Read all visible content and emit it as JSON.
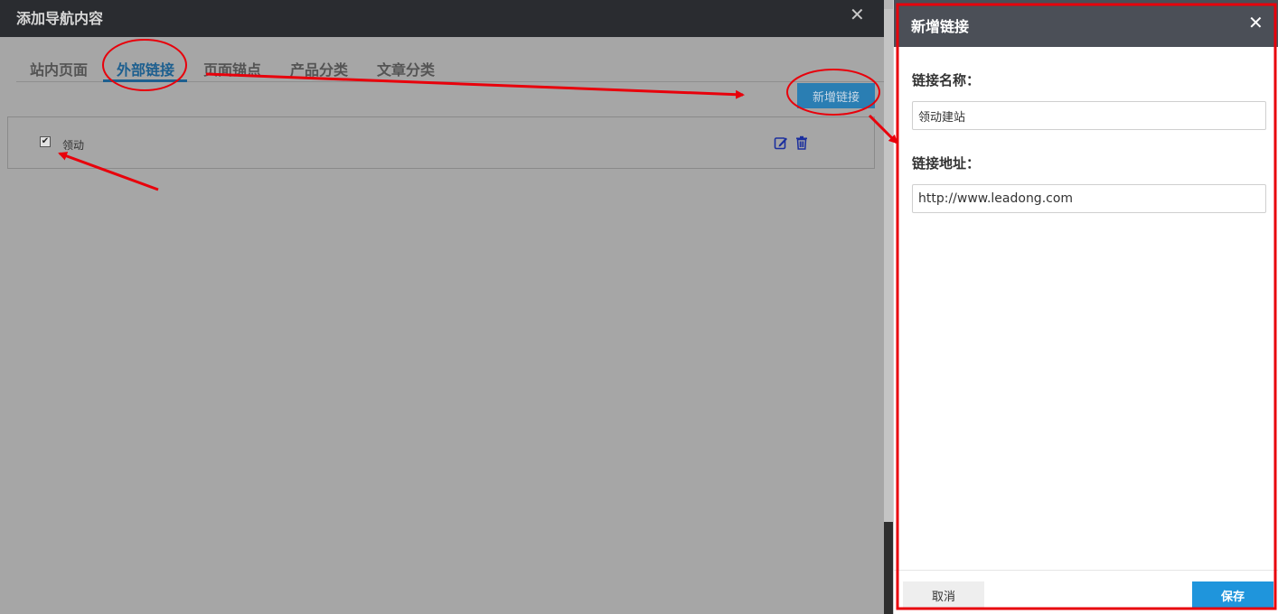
{
  "left_dialog": {
    "title": "添加导航内容",
    "close_glyph": "✕",
    "tabs": [
      {
        "label": "站内页面",
        "active": false
      },
      {
        "label": "外部链接",
        "active": true
      },
      {
        "label": "页面锚点",
        "active": false
      },
      {
        "label": "产品分类",
        "active": false
      },
      {
        "label": "文章分类",
        "active": false
      }
    ],
    "add_link_button": "新增链接",
    "links": [
      {
        "name": "领动",
        "checked": true,
        "edit_icon": "edit-icon",
        "delete_icon": "trash-icon"
      }
    ]
  },
  "right_panel": {
    "title": "新增链接",
    "close_glyph": "✕",
    "name_label": "链接名称：",
    "name_value": "领动建站",
    "url_label": "链接地址：",
    "url_value": "http://www.leadong.com",
    "cancel_button": "取消",
    "save_button": "保存"
  },
  "colors": {
    "accent": "#1f95dc",
    "tab_active": "#1d5f8f",
    "annotation": "#e8000b",
    "header_dark": "#2a2c30",
    "panel_header": "#4b4f57"
  }
}
